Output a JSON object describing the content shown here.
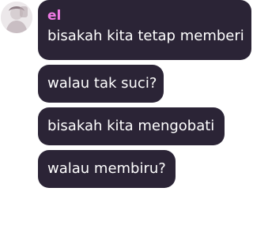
{
  "chat": {
    "sender_name": "el",
    "sender_color": "#f07ae6",
    "bubble_color": "#2b2436",
    "avatar_icon": "profile-photo",
    "messages": [
      "bisakah kita tetap memberi",
      "walau tak suci?",
      "bisakah kita mengobati",
      "walau membiru?"
    ]
  }
}
